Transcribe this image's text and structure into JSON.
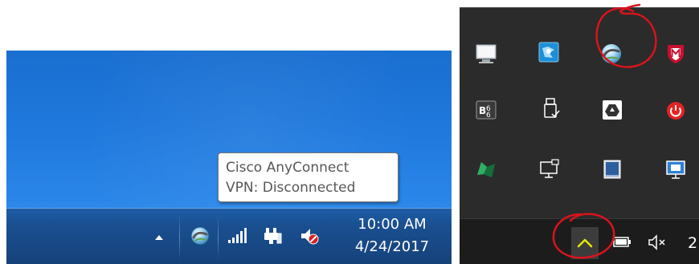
{
  "win7": {
    "tooltip": {
      "line1": "Cisco AnyConnect",
      "line2": "VPN: Disconnected"
    },
    "tray": {
      "icons": [
        "show-hidden-icons-arrow-icon",
        "cisco-anyconnect-icon",
        "network-signal-icon",
        "power-plug-icon",
        "volume-muted-icon"
      ]
    },
    "clock": {
      "time": "10:00 AM",
      "date": "4/24/2017"
    }
  },
  "win10": {
    "overflow_icons": [
      "computer-monitor-icon",
      "network-map-icon",
      "cisco-anyconnect-icon",
      "mcafee-icon",
      "bluetooth-app-icon",
      "usb-drive-icon",
      "google-drive-icon",
      "power-red-icon",
      "green-app-icon",
      "desktop-network-icon",
      "display-window-icon",
      "remote-screen-icon"
    ],
    "taskbar": {
      "chevron_icon": "chevron-up-icon",
      "clock_partial": "2"
    }
  },
  "colors": {
    "win7_desktop": "#1f78dc",
    "win7_taskbar": "#1a4f90",
    "win10_flyout": "#2b2b2b",
    "win10_taskbar": "#1c1c1c",
    "annotation": "#d8141c",
    "chevron_highlight": "#e0e000"
  }
}
